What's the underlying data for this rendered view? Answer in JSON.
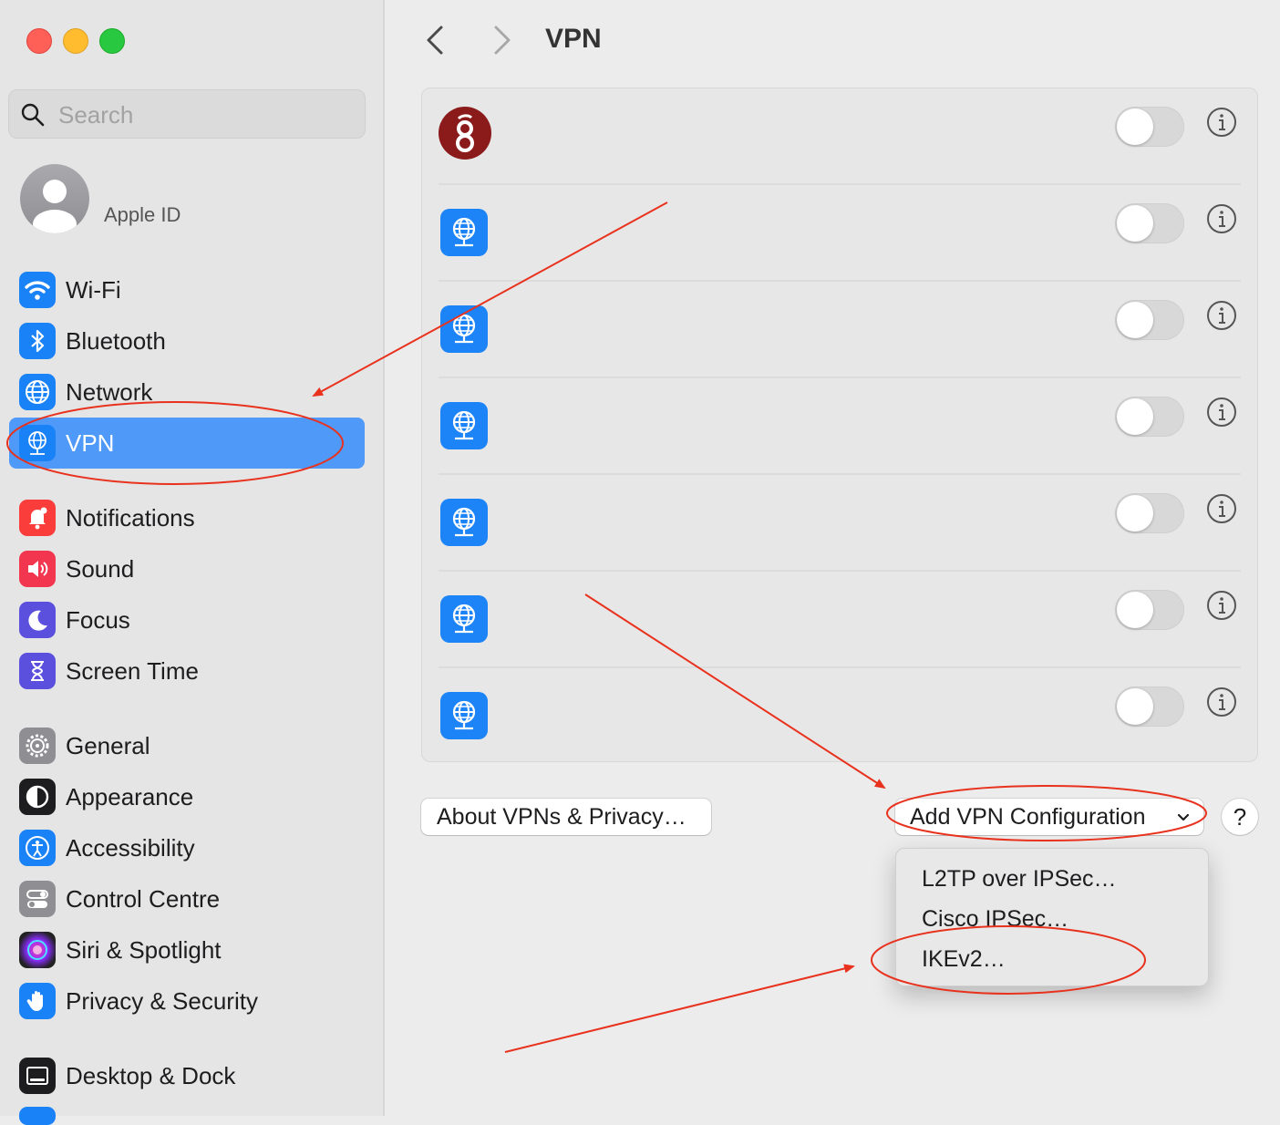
{
  "sidebar": {
    "search_placeholder": "Search",
    "apple_id_label": "Apple ID",
    "groups": [
      {
        "items": [
          {
            "label": "Wi-Fi",
            "icon": "wifi-icon"
          },
          {
            "label": "Bluetooth",
            "icon": "bluetooth-icon"
          },
          {
            "label": "Network",
            "icon": "network-icon"
          },
          {
            "label": "VPN",
            "icon": "vpn-icon",
            "selected": true
          }
        ]
      },
      {
        "items": [
          {
            "label": "Notifications",
            "icon": "bell-icon"
          },
          {
            "label": "Sound",
            "icon": "speaker-icon"
          },
          {
            "label": "Focus",
            "icon": "moon-icon"
          },
          {
            "label": "Screen Time",
            "icon": "hourglass-icon"
          }
        ]
      },
      {
        "items": [
          {
            "label": "General",
            "icon": "gear-icon"
          },
          {
            "label": "Appearance",
            "icon": "appearance-icon"
          },
          {
            "label": "Accessibility",
            "icon": "accessibility-icon"
          },
          {
            "label": "Control Centre",
            "icon": "control-centre-icon"
          },
          {
            "label": "Siri & Spotlight",
            "icon": "siri-icon"
          },
          {
            "label": "Privacy & Security",
            "icon": "hand-icon"
          }
        ]
      },
      {
        "items": [
          {
            "label": "Desktop & Dock",
            "icon": "dock-icon"
          }
        ]
      }
    ]
  },
  "main": {
    "title": "VPN",
    "vpn_list": [
      {
        "icon": "wireguard-icon",
        "enabled": false
      },
      {
        "icon": "vpn-globe-icon",
        "enabled": false
      },
      {
        "icon": "vpn-globe-icon",
        "enabled": false
      },
      {
        "icon": "vpn-globe-icon",
        "enabled": false
      },
      {
        "icon": "vpn-globe-icon",
        "enabled": false
      },
      {
        "icon": "vpn-globe-icon",
        "enabled": false
      },
      {
        "icon": "vpn-globe-icon",
        "enabled": false
      }
    ],
    "about_button": "About VPNs & Privacy…",
    "add_button": "Add VPN Configuration",
    "help_button": "?",
    "menu": {
      "items": [
        "L2TP over IPSec…",
        "Cisco IPSec…",
        "IKEv2…"
      ]
    }
  },
  "colors": {
    "accent": "#4f99f9",
    "vpn_icon": "#1d84f7",
    "annotation": "#e8321e"
  }
}
